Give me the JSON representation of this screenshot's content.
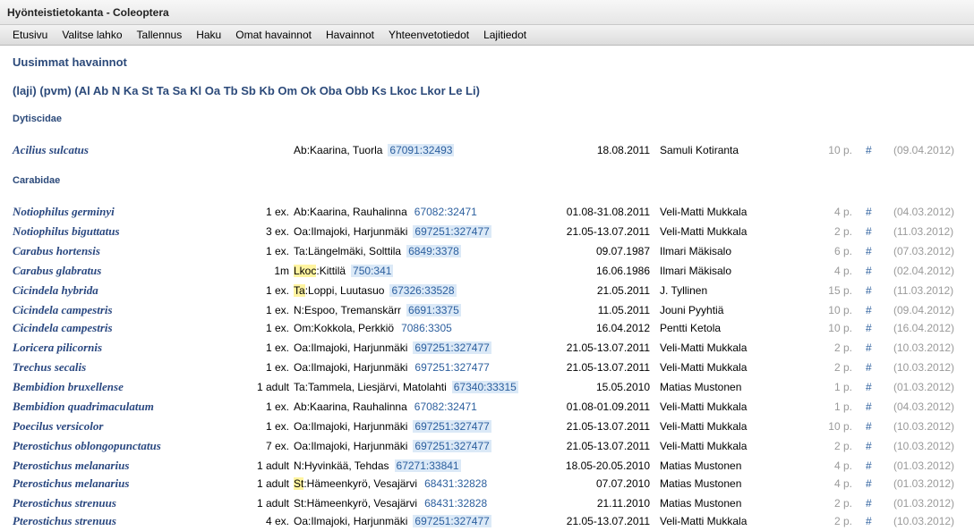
{
  "window": {
    "title": "Hyönteistietokanta - Coleoptera"
  },
  "menu": [
    "Etusivu",
    "Valitse lahko",
    "Tallennus",
    "Haku",
    "Omat havainnot",
    "Havainnot",
    "Yhteenvetotiedot",
    "Lajitiedot"
  ],
  "page": {
    "title": "Uusimmat havainnot",
    "filters": [
      "(laji)",
      "(pvm)",
      "(Al",
      "Ab",
      "N",
      "Ka",
      "St",
      "Ta",
      "Sa",
      "Kl",
      "Oa",
      "Tb",
      "Sb",
      "Kb",
      "Om",
      "Ok",
      "Oba",
      "Obb",
      "Ks",
      "Lkoc",
      "Lkor",
      "Le",
      "Li)"
    ]
  },
  "sections": [
    {
      "family": "Dytiscidae",
      "rows": [
        {
          "species": "Acilius sulcatus",
          "count": "",
          "prov": "Ab",
          "place": ":Kaarina, Tuorla",
          "hl": false,
          "coord": "67091:32493",
          "coordBox": true,
          "date": "18.08.2011",
          "observer": "Samuli Kotiranta",
          "num": "10 p.",
          "hash": "#",
          "added": "(09.04.2012)"
        }
      ]
    },
    {
      "family": "Carabidae",
      "rows": [
        {
          "species": "Notiophilus germinyi",
          "count": "1 ex.",
          "prov": "Ab",
          "place": ":Kaarina, Rauhalinna",
          "hl": false,
          "coord": "67082:32471",
          "coordBox": false,
          "date": "01.08-31.08.2011",
          "observer": "Veli-Matti Mukkala",
          "num": "4 p.",
          "hash": "#",
          "added": "(04.03.2012)"
        },
        {
          "species": "Notiophilus biguttatus",
          "count": "3 ex.",
          "prov": "Oa",
          "place": ":Ilmajoki, Harjunmäki",
          "hl": false,
          "coord": "697251:327477",
          "coordBox": true,
          "date": "21.05-13.07.2011",
          "observer": "Veli-Matti Mukkala",
          "num": "2 p.",
          "hash": "#",
          "added": "(11.03.2012)"
        },
        {
          "species": "Carabus hortensis",
          "count": "1 ex.",
          "prov": "Ta",
          "place": ":Längelmäki, Solttila",
          "hl": false,
          "coord": "6849:3378",
          "coordBox": true,
          "date": "09.07.1987",
          "observer": "Ilmari Mäkisalo",
          "num": "6 p.",
          "hash": "#",
          "added": "(07.03.2012)"
        },
        {
          "species": "Carabus glabratus",
          "count": "1m",
          "prov": "Lkoc",
          "place": ":Kittilä",
          "hl": true,
          "coord": "750:341",
          "coordBox": true,
          "date": "16.06.1986",
          "observer": "Ilmari Mäkisalo",
          "num": "4 p.",
          "hash": "#",
          "added": "(02.04.2012)"
        },
        {
          "species": "Cicindela hybrida",
          "count": "1 ex.",
          "prov": "Ta",
          "place": ":Loppi, Luutasuo",
          "hl": true,
          "coord": "67326:33528",
          "coordBox": true,
          "date": "21.05.2011",
          "observer": "J. Tyllinen",
          "num": "15 p.",
          "hash": "#",
          "added": "(11.03.2012)"
        },
        {
          "species": "Cicindela campestris",
          "count": "1 ex.",
          "prov": "N",
          "place": ":Espoo, Tremanskärr",
          "hl": false,
          "coord": "6691:3375",
          "coordBox": true,
          "date": "11.05.2011",
          "observer": "Jouni Pyyhtiä",
          "num": "10 p.",
          "hash": "#",
          "added": "(09.04.2012)"
        },
        {
          "species": "Cicindela campestris",
          "count": "1 ex.",
          "prov": "Om",
          "place": ":Kokkola, Perkkiö",
          "hl": false,
          "coord": "7086:3305",
          "coordBox": false,
          "date": "16.04.2012",
          "observer": "Pentti Ketola",
          "num": "10 p.",
          "hash": "#",
          "added": "(16.04.2012)"
        },
        {
          "species": "Loricera pilicornis",
          "count": "1 ex.",
          "prov": "Oa",
          "place": ":Ilmajoki, Harjunmäki",
          "hl": false,
          "coord": "697251:327477",
          "coordBox": true,
          "date": "21.05-13.07.2011",
          "observer": "Veli-Matti Mukkala",
          "num": "2 p.",
          "hash": "#",
          "added": "(10.03.2012)"
        },
        {
          "species": "Trechus secalis",
          "count": "1 ex.",
          "prov": "Oa",
          "place": ":Ilmajoki, Harjunmäki",
          "hl": false,
          "coord": "697251:327477",
          "coordBox": false,
          "date": "21.05-13.07.2011",
          "observer": "Veli-Matti Mukkala",
          "num": "2 p.",
          "hash": "#",
          "added": "(10.03.2012)"
        },
        {
          "species": "Bembidion bruxellense",
          "count": "1 adult",
          "prov": "Ta",
          "place": ":Tammela, Liesjärvi, Matolahti",
          "hl": false,
          "coord": "67340:33315",
          "coordBox": true,
          "date": "15.05.2010",
          "observer": "Matias Mustonen",
          "num": "1 p.",
          "hash": "#",
          "added": "(01.03.2012)"
        },
        {
          "species": "Bembidion quadrimaculatum",
          "count": "1 ex.",
          "prov": "Ab",
          "place": ":Kaarina, Rauhalinna",
          "hl": false,
          "coord": "67082:32471",
          "coordBox": false,
          "date": "01.08-01.09.2011",
          "observer": "Veli-Matti Mukkala",
          "num": "1 p.",
          "hash": "#",
          "added": "(04.03.2012)"
        },
        {
          "species": "Poecilus versicolor",
          "count": "1 ex.",
          "prov": "Oa",
          "place": ":Ilmajoki, Harjunmäki",
          "hl": false,
          "coord": "697251:327477",
          "coordBox": true,
          "date": "21.05-13.07.2011",
          "observer": "Veli-Matti Mukkala",
          "num": "10 p.",
          "hash": "#",
          "added": "(10.03.2012)"
        },
        {
          "species": "Pterostichus oblongopunctatus",
          "count": "7 ex.",
          "prov": "Oa",
          "place": ":Ilmajoki, Harjunmäki",
          "hl": false,
          "coord": "697251:327477",
          "coordBox": true,
          "date": "21.05-13.07.2011",
          "observer": "Veli-Matti Mukkala",
          "num": "2 p.",
          "hash": "#",
          "added": "(10.03.2012)"
        },
        {
          "species": "Pterostichus melanarius",
          "count": "1 adult",
          "prov": "N",
          "place": ":Hyvinkää, Tehdas",
          "hl": false,
          "coord": "67271:33841",
          "coordBox": true,
          "date": "18.05-20.05.2010",
          "observer": "Matias Mustonen",
          "num": "4 p.",
          "hash": "#",
          "added": "(01.03.2012)"
        },
        {
          "species": "Pterostichus melanarius",
          "count": "1 adult",
          "prov": "St",
          "place": ":Hämeenkyrö, Vesajärvi",
          "hl": true,
          "coord": "68431:32828",
          "coordBox": false,
          "date": "07.07.2010",
          "observer": "Matias Mustonen",
          "num": "4 p.",
          "hash": "#",
          "added": "(01.03.2012)"
        },
        {
          "species": "Pterostichus strenuus",
          "count": "1 adult",
          "prov": "St",
          "place": ":Hämeenkyrö, Vesajärvi",
          "hl": false,
          "coord": "68431:32828",
          "coordBox": false,
          "date": "21.11.2010",
          "observer": "Matias Mustonen",
          "num": "2 p.",
          "hash": "#",
          "added": "(01.03.2012)"
        },
        {
          "species": "Pterostichus strenuus",
          "count": "4 ex.",
          "prov": "Oa",
          "place": ":Ilmajoki, Harjunmäki",
          "hl": false,
          "coord": "697251:327477",
          "coordBox": true,
          "date": "21.05-13.07.2011",
          "observer": "Veli-Matti Mukkala",
          "num": "2 p.",
          "hash": "#",
          "added": "(10.03.2012)"
        }
      ]
    }
  ]
}
